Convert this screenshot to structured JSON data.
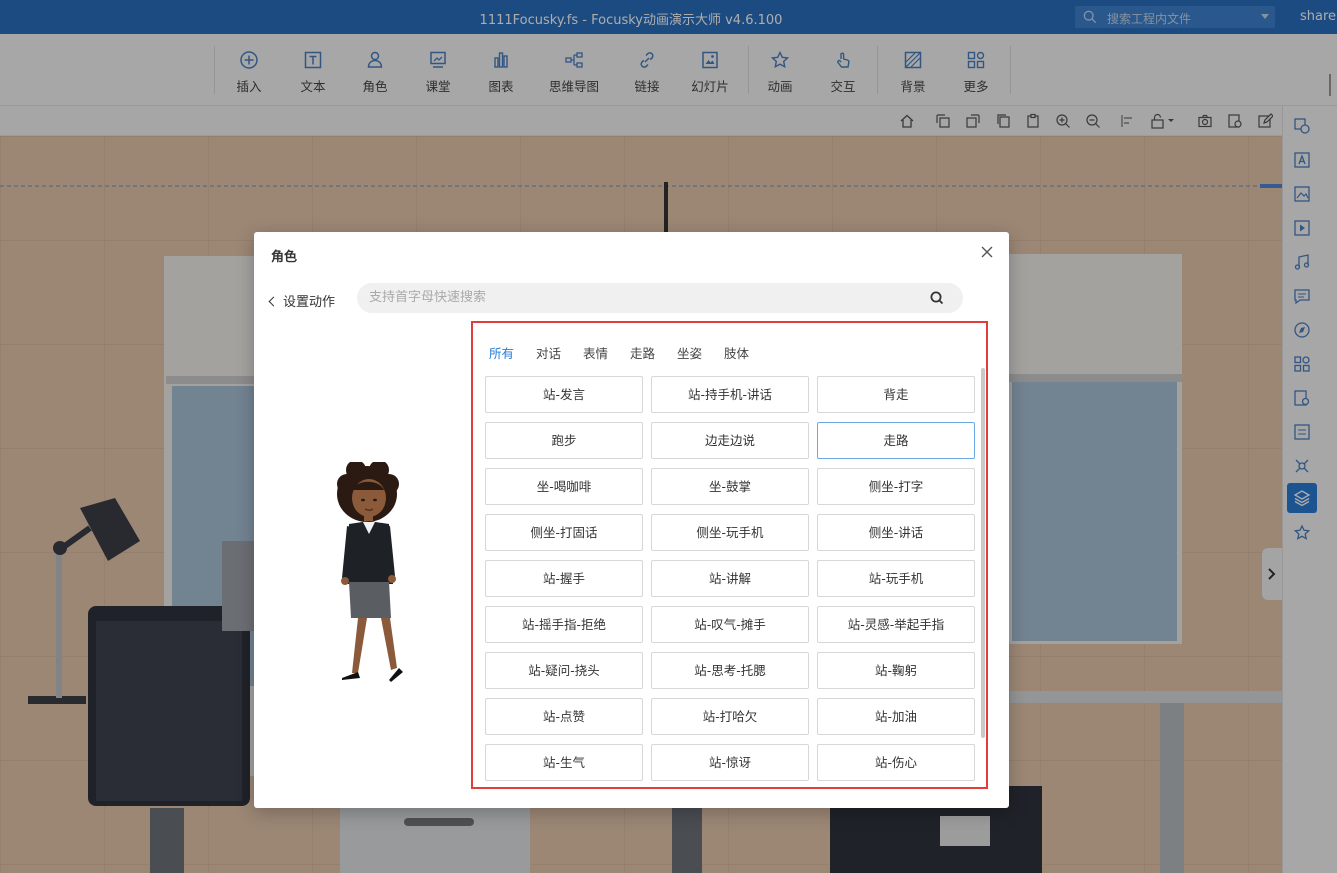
{
  "window": {
    "title": "1111Focusky.fs - Focusky动画演示大师  v4.6.100",
    "search_placeholder": "搜索工程内文件",
    "user": "share("
  },
  "toolbar": {
    "items": [
      {
        "label": "插入",
        "icon": "plus-circle-icon"
      },
      {
        "label": "文本",
        "icon": "text-icon"
      },
      {
        "label": "角色",
        "icon": "character-icon"
      },
      {
        "label": "课堂",
        "icon": "classroom-icon"
      },
      {
        "label": "图表",
        "icon": "chart-icon"
      },
      {
        "label": "思维导图",
        "icon": "mindmap-icon"
      },
      {
        "label": "链接",
        "icon": "link-icon"
      },
      {
        "label": "幻灯片",
        "icon": "slides-icon"
      },
      {
        "label": "动画",
        "icon": "animation-star-icon"
      },
      {
        "label": "交互",
        "icon": "interaction-icon"
      },
      {
        "label": "背景",
        "icon": "background-icon"
      },
      {
        "label": "更多",
        "icon": "more-grid-icon"
      }
    ]
  },
  "dialog": {
    "title": "角色",
    "back_label": "设置动作",
    "search_placeholder": "支持首字母快速搜索",
    "tabs": [
      "所有",
      "对话",
      "表情",
      "走路",
      "坐姿",
      "肢体"
    ],
    "active_tab": "所有",
    "actions": [
      "站-发言",
      "站-持手机-讲话",
      "背走",
      "跑步",
      "边走边说",
      "走路",
      "坐-喝咖啡",
      "坐-鼓掌",
      "侧坐-打字",
      "侧坐-打固话",
      "侧坐-玩手机",
      "侧坐-讲话",
      "站-握手",
      "站-讲解",
      "站-玩手机",
      "站-摇手指-拒绝",
      "站-叹气-摊手",
      "站-灵感-举起手指",
      "站-疑问-挠头",
      "站-思考-托腮",
      "站-鞠躬",
      "站-点赞",
      "站-打哈欠",
      "站-加油",
      "站-生气",
      "站-惊讶",
      "站-伤心"
    ],
    "selected_action": "走路"
  },
  "colors": {
    "titlebar": "#2a6fc0",
    "accent": "#2a7bd6",
    "highlight_border": "#e03d3d",
    "canvas": "#e6c7ad"
  }
}
